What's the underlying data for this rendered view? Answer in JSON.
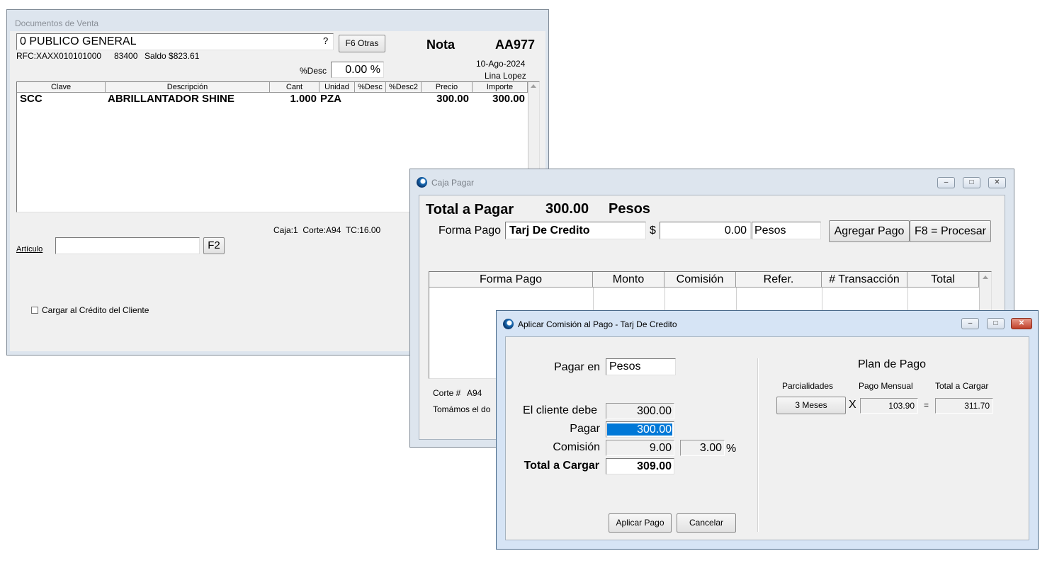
{
  "doc_window": {
    "title": "Documentos de Venta",
    "customer": "0 PUBLICO GENERAL",
    "question_mark": "?",
    "other_button": "F6 Otras",
    "rfc": "RFC:XAXX010101000",
    "customer_code": "83400",
    "balance": "Saldo $823.61",
    "doc_type": "Nota",
    "doc_number": "AA977",
    "date": "10-Ago-2024",
    "user": "Lina Lopez",
    "discount_label": "%Desc",
    "discount_value": "0.00 %",
    "columns": [
      "Clave",
      "Descripción",
      "Cant",
      "Unidad",
      "%Desc",
      "%Desc2",
      "Precio",
      "Importe"
    ],
    "rows": [
      {
        "clave": "SCC",
        "descripcion": "ABRILLANTADOR SHINE",
        "cant": "1.000",
        "unidad": "PZA",
        "desc": "",
        "desc2": "",
        "precio": "300.00",
        "importe": "300.00"
      }
    ],
    "caja_info": "Caja:1  Corte:A94  TC:16.00",
    "articulo_label": "Artículo",
    "articulo_value": "",
    "f2_button": "F2",
    "credit_checkbox_label": "Cargar al Crédito del Cliente",
    "credit_checkbox_checked": false
  },
  "caja_window": {
    "title": "Caja Pagar",
    "total_label": "Total a Pagar",
    "total_value": "300.00",
    "currency": "Pesos",
    "forma_pago_label": "Forma Pago",
    "forma_pago_value": "Tarj De Credito",
    "dollar_sign": "$",
    "amount_value": "0.00",
    "amount_currency": "Pesos",
    "add_payment_button": "Agregar Pago",
    "process_button": "F8 = Procesar",
    "columns": [
      "Forma Pago",
      "Monto",
      "Comisión",
      "Refer.",
      "# Transacción",
      "Total"
    ],
    "corte_label": "Corte #",
    "corte_value": "A94",
    "note_text": "Tomámos el do"
  },
  "commission_window": {
    "title": "Aplicar Comisión al Pago - Tarj De Credito",
    "pagar_en_label": "Pagar en",
    "pagar_en_value": "Pesos",
    "cliente_debe_label": "El cliente debe",
    "cliente_debe_value": "300.00",
    "pagar_label": "Pagar",
    "pagar_value": "300.00",
    "comision_label": "Comisión",
    "comision_value": "9.00",
    "comision_pct_value": "3.00",
    "pct_sign": "%",
    "total_cargar_label": "Total a Cargar",
    "total_cargar_value": "309.00",
    "plan_title": "Plan de Pago",
    "parcialidades_label": "Parcialidades",
    "pago_mensual_label": "Pago Mensual",
    "total_a_cargar_label": "Total a Cargar",
    "months_button": "3 Meses",
    "times_sign": "X",
    "pago_mensual_value": "103.90",
    "equals_sign": "=",
    "plan_total_value": "311.70",
    "apply_button": "Aplicar Pago",
    "cancel_button": "Cancelar"
  },
  "colors": {
    "frame_inactive": "#dde5ee",
    "frame_active": "#d6e4f5",
    "selection": "#0078d7",
    "panel": "#f0f0f0"
  }
}
